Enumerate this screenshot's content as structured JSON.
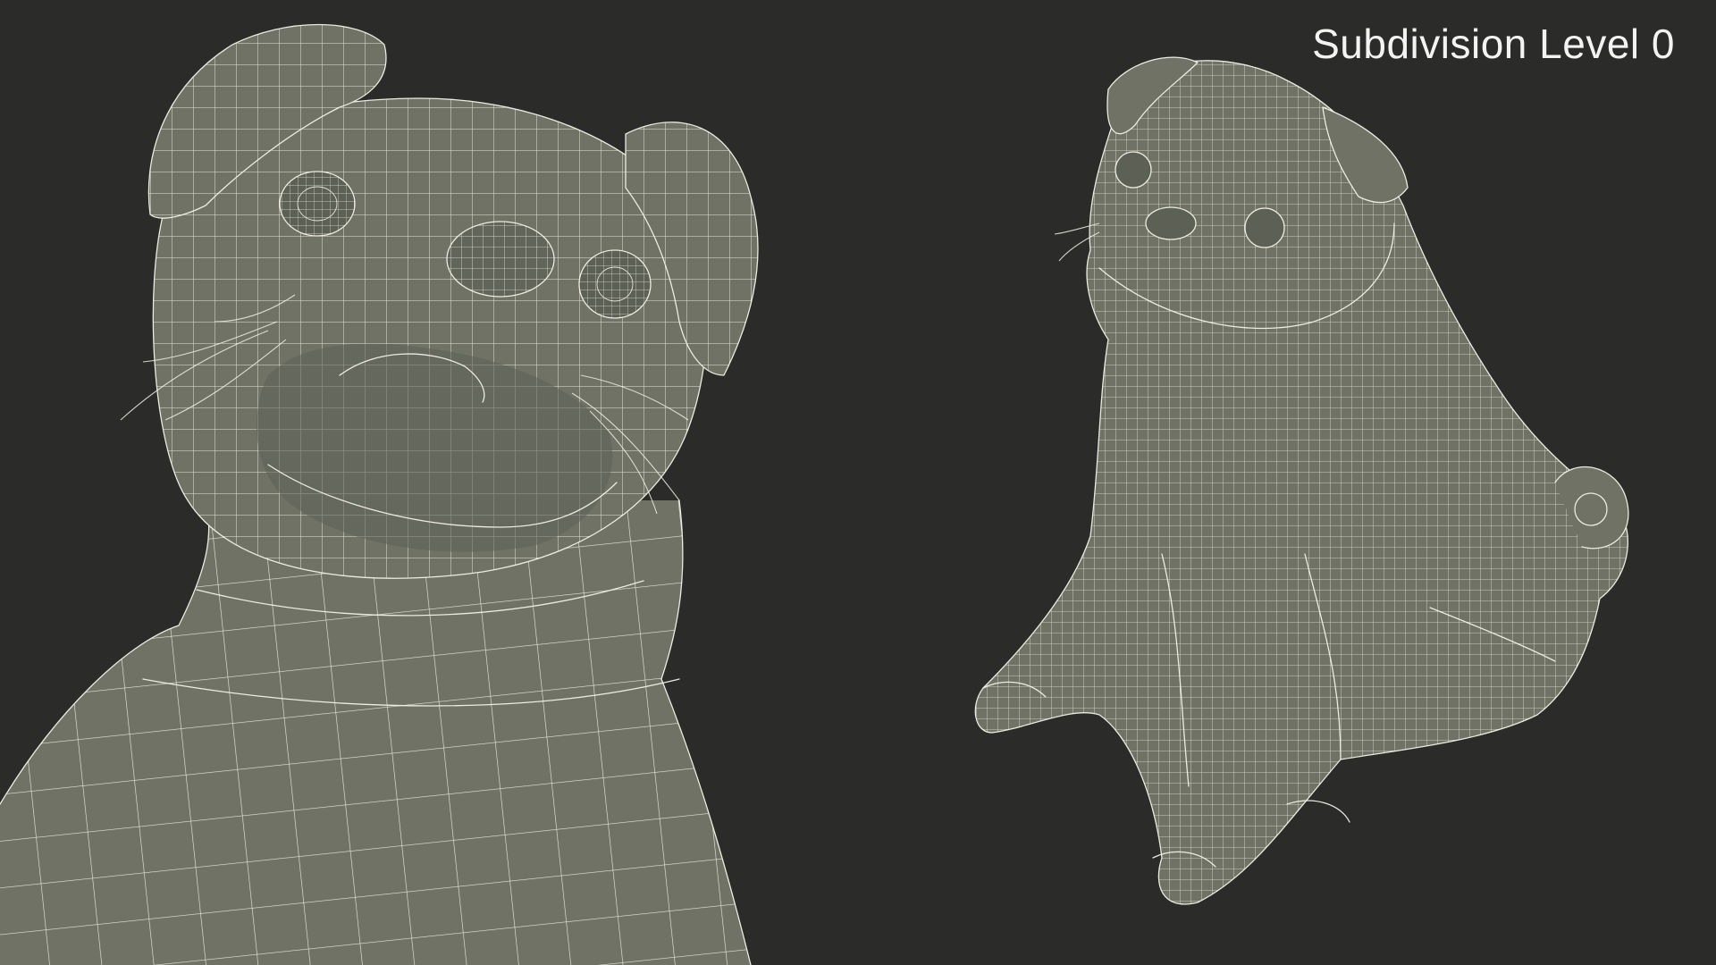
{
  "view": {
    "label": "Subdivision Level 0",
    "background_color": "#2b2b29",
    "mesh_color": "#6f7264",
    "wire_color": "#f4f2e8"
  },
  "renders": [
    {
      "name": "pug-closeup-view"
    },
    {
      "name": "pug-fullbody-view"
    }
  ]
}
